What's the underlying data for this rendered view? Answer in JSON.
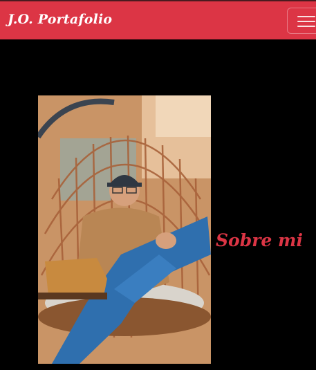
{
  "navbar": {
    "brand": "J.O. Portafolio",
    "toggler_icon": "hamburger-menu-icon",
    "background_color": "#dc3545"
  },
  "about": {
    "title": "Sobre mi",
    "title_color": "#dc3545",
    "photo_subject": "profile-photo"
  }
}
